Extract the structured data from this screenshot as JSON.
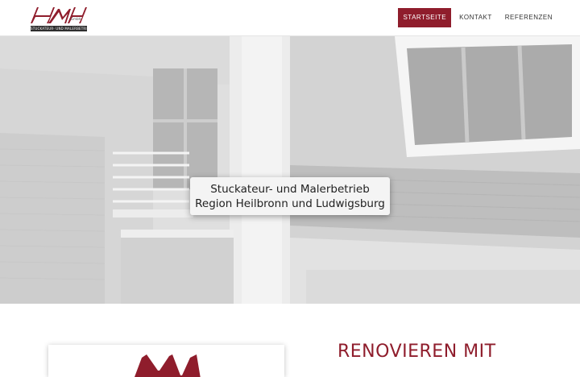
{
  "logo": {
    "tagline": "STUCKATEUR- UND MALERBETRIEB",
    "suffix": "GmbH",
    "brand_color": "#8f1d2c"
  },
  "nav": {
    "items": [
      {
        "label": "STARTSEITE",
        "active": true
      },
      {
        "label": "KONTAKT",
        "active": false
      },
      {
        "label": "REFERENZEN",
        "active": false
      }
    ]
  },
  "hero": {
    "line1": "Stuckateur- und Malerbetrieb",
    "line2": "Region Heilbronn und Ludwigsburg"
  },
  "section": {
    "heading": "RENOVIEREN MIT"
  },
  "colors": {
    "accent": "#8f1d2c",
    "text": "#333333",
    "hero_bg": "#d9d9d9"
  }
}
